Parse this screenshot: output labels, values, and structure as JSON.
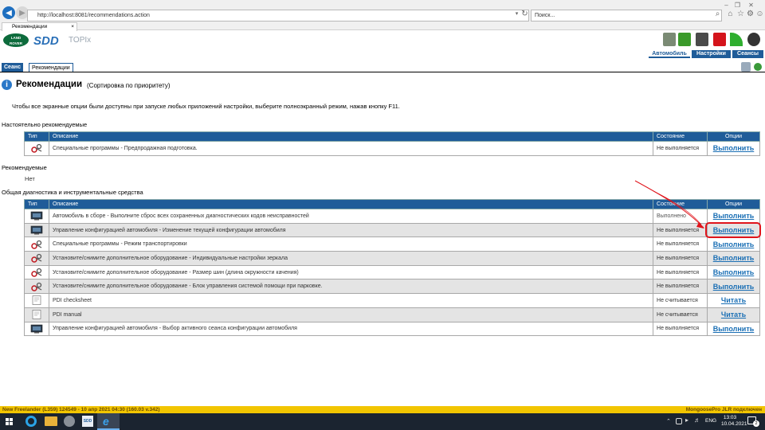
{
  "browser": {
    "url": "http://localhost:8081/recommendations.action",
    "search_placeholder": "Поиск...",
    "tab_title": "Рекомендации"
  },
  "app": {
    "logo_text": "LAND ROVER",
    "brand": "SDD",
    "product": "TOPIx",
    "nav_tabs": [
      "Автомобиль",
      "Настройки",
      "Сеансы"
    ]
  },
  "section_tabs": [
    "Сеанс",
    "Рекомендации"
  ],
  "page": {
    "title": "Рекомендации",
    "subtitle": "(Сортировка по приоритету)",
    "notice": "Чтобы все экранные опции были доступны при запуске любых приложений настройки, выберите полноэкранный режим, нажав кнопку F11."
  },
  "columns": {
    "type": "Тип",
    "description": "Описание",
    "state": "Состояние",
    "options": "Опции"
  },
  "strongly_recommended": {
    "heading": "Настоятельно рекомендуемые",
    "rows": [
      {
        "icon": "tools-icon",
        "description": "Специальные программы - Предпродажная подготовка.",
        "state": "Не выполняется",
        "action": "Выполнить"
      }
    ]
  },
  "recommended": {
    "heading": "Рекомендуемые",
    "empty_text": "Нет"
  },
  "general": {
    "heading": "Общая диагностика и инструментальные средства",
    "rows": [
      {
        "icon": "monitor-icon",
        "description": "Автомобиль в сборе - Выполните сброс всех сохраненных диагностических кодов неисправностей",
        "state": "Выполнено",
        "action": "Выполнить"
      },
      {
        "icon": "monitor-icon",
        "description": "Управление конфигурацией автомобиля - Изменение текущей конфигурации автомобиля",
        "state": "Не выполняется",
        "action": "Выполнить"
      },
      {
        "icon": "tools-icon",
        "description": "Специальные программы - Режим транспортировки",
        "state": "Не выполняется",
        "action": "Выполнить"
      },
      {
        "icon": "tools-icon",
        "description": "Установите/снимите дополнительное оборудование - Индивидуальные настройки зеркала",
        "state": "Не выполняется",
        "action": "Выполнить"
      },
      {
        "icon": "tools-icon",
        "description": "Установите/снимите дополнительное оборудование - Размер шин (длина окружности качения)",
        "state": "Не выполняется",
        "action": "Выполнить"
      },
      {
        "icon": "tools-icon",
        "description": "Установите/снимите дополнительное оборудование - Блок управления системой помощи при парковке.",
        "state": "Не выполняется",
        "action": "Выполнить"
      },
      {
        "icon": "document-icon",
        "description": "PDI checksheet",
        "state": "Не считывается",
        "action": "Читать"
      },
      {
        "icon": "document-icon",
        "description": "PDI manual",
        "state": "Не считывается",
        "action": "Читать"
      },
      {
        "icon": "monitor-icon",
        "description": "Управление конфигурацией автомобиля - Выбор активного сеанса конфигурации автомобиля",
        "state": "Не выполняется",
        "action": "Выполнить"
      }
    ]
  },
  "status_bar": {
    "left": "New Freelander (L359) 124549 - 10 апр 2021 04:30 (160.03 v.342)",
    "right": "MongoosePro JLR подключен"
  },
  "taskbar": {
    "lang": "ENG",
    "time": "13:03",
    "date": "10.04.2021",
    "notifications": "2"
  },
  "colors": {
    "header_blue": "#1f5c99",
    "link_blue": "#1a6fb5",
    "status_yellow": "#f2c500",
    "highlight_red": "#e0141b"
  }
}
